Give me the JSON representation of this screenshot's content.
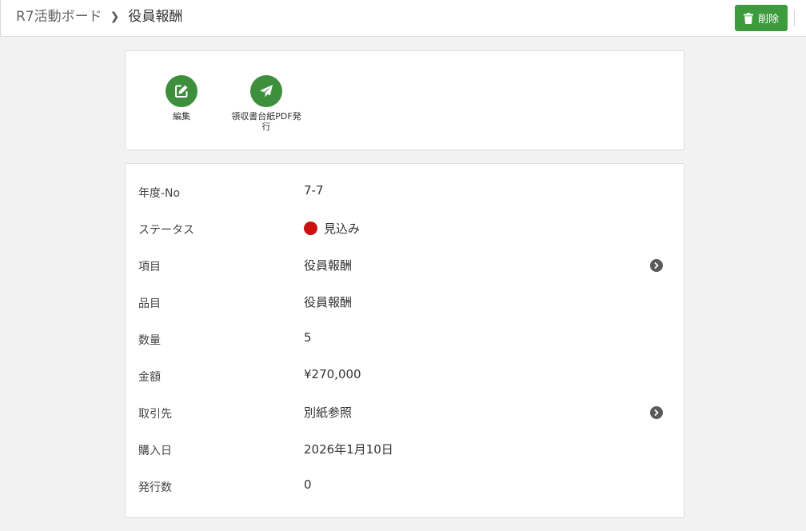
{
  "breadcrumb": {
    "parent": "R7活動ボード",
    "current": "役員報酬"
  },
  "header": {
    "delete_label": "削除",
    "delete_icon": "trash-icon"
  },
  "actions": [
    {
      "label": "編集",
      "icon": "edit-icon"
    },
    {
      "label": "領収書台紙PDF発行",
      "icon": "send-icon"
    }
  ],
  "fields": [
    {
      "label": "年度-No",
      "value": "7-7"
    },
    {
      "label": "ステータス",
      "value": "見込み",
      "status_color": "#cc1111"
    },
    {
      "label": "項目",
      "value": "役員報酬",
      "link": true
    },
    {
      "label": "品目",
      "value": "役員報酬"
    },
    {
      "label": "数量",
      "value": "5"
    },
    {
      "label": "金額",
      "value": "¥270,000"
    },
    {
      "label": "取引先",
      "value": "別紙参照",
      "link": true
    },
    {
      "label": "購入日",
      "value": "2026年1月10日"
    },
    {
      "label": "発行数",
      "value": "0"
    }
  ],
  "colors": {
    "primary_green": "#3d9a3d",
    "status_red": "#cc1111"
  }
}
